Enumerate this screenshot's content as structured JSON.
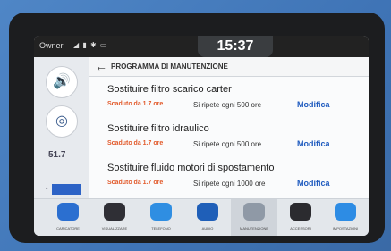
{
  "status_bar": {
    "owner": "Owner",
    "icons_text": "◢ ▮ ✱ ▭",
    "time": "15:37"
  },
  "sidebar": {
    "odometer": "51.7"
  },
  "header": {
    "back_label": "←",
    "title": "PROGRAMMA DI MANUTENZIONE"
  },
  "maintenance_items": [
    {
      "title": "Sostituire filtro scarico carter",
      "due_text": "Scaduto da 1.7 ore",
      "repeat_text": "Si ripete ogni 500 ore",
      "action": "Modifica"
    },
    {
      "title": "Sostituire filtro idraulico",
      "due_text": "Scaduto da 1.7 ore",
      "repeat_text": "Si ripete ogni 500 ore",
      "action": "Modifica"
    },
    {
      "title": "Sostituire fluido motori di spostamento",
      "due_text": "Scaduto da 1.7 ore",
      "repeat_text": "Si ripete ogni 1000 ore",
      "action": "Modifica"
    }
  ],
  "dock": [
    {
      "label": "CARICATORE",
      "icon": "home-icon",
      "color": "#2b6fd0"
    },
    {
      "label": "VISUALIZZARE",
      "icon": "gauge-icon",
      "color": "#2f2f35"
    },
    {
      "label": "TELEFONO",
      "icon": "phone-icon",
      "color": "#2f8ee2"
    },
    {
      "label": "AUDIO",
      "icon": "audio-icon",
      "color": "#1f5fb8"
    },
    {
      "label": "MANUTENZIONE",
      "icon": "wrench-icon",
      "color": "#8f99a6"
    },
    {
      "label": "ACCESSORI",
      "icon": "accessory-icon",
      "color": "#2b2b2f"
    },
    {
      "label": "IMPOSTAZIONI",
      "icon": "settings-icon",
      "color": "#2d8ce4"
    }
  ]
}
